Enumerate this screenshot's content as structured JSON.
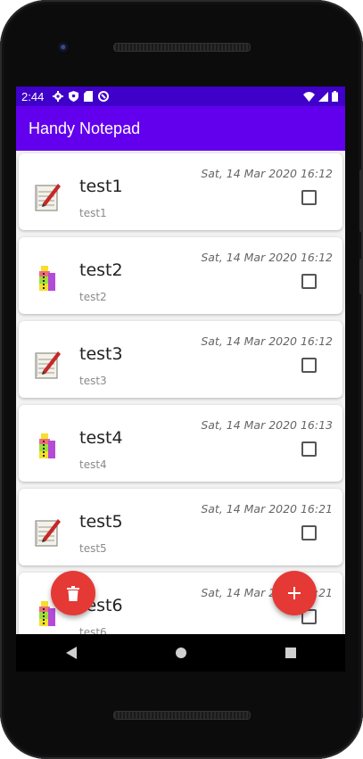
{
  "status_bar": {
    "time": "2:44"
  },
  "app_bar": {
    "title": "Handy Notepad"
  },
  "notes": [
    {
      "title": "test1",
      "subtitle": "test1",
      "date": "Sat, 14 Mar 2020 16:12",
      "icon": "notepad-pencil-icon",
      "checked": false
    },
    {
      "title": "test2",
      "subtitle": "test2",
      "date": "Sat, 14 Mar 2020 16:12",
      "icon": "zip-archive-icon",
      "checked": false
    },
    {
      "title": "test3",
      "subtitle": "test3",
      "date": "Sat, 14 Mar 2020 16:12",
      "icon": "notepad-pencil-icon",
      "checked": false
    },
    {
      "title": "test4",
      "subtitle": "test4",
      "date": "Sat, 14 Mar 2020 16:13",
      "icon": "zip-archive-icon",
      "checked": false
    },
    {
      "title": "test5",
      "subtitle": "test5",
      "date": "Sat, 14 Mar 2020 16:21",
      "icon": "notepad-pencil-icon",
      "checked": false
    },
    {
      "title": "test6",
      "subtitle": "test6",
      "date": "Sat, 14 Mar 2020 16:21",
      "icon": "zip-archive-icon",
      "checked": false
    }
  ],
  "fabs": {
    "delete_icon": "trash-icon",
    "add_icon": "plus-icon"
  },
  "colors": {
    "app_bar": "#6200ee",
    "status_bar": "#3f00c9",
    "fab": "#e53935"
  }
}
